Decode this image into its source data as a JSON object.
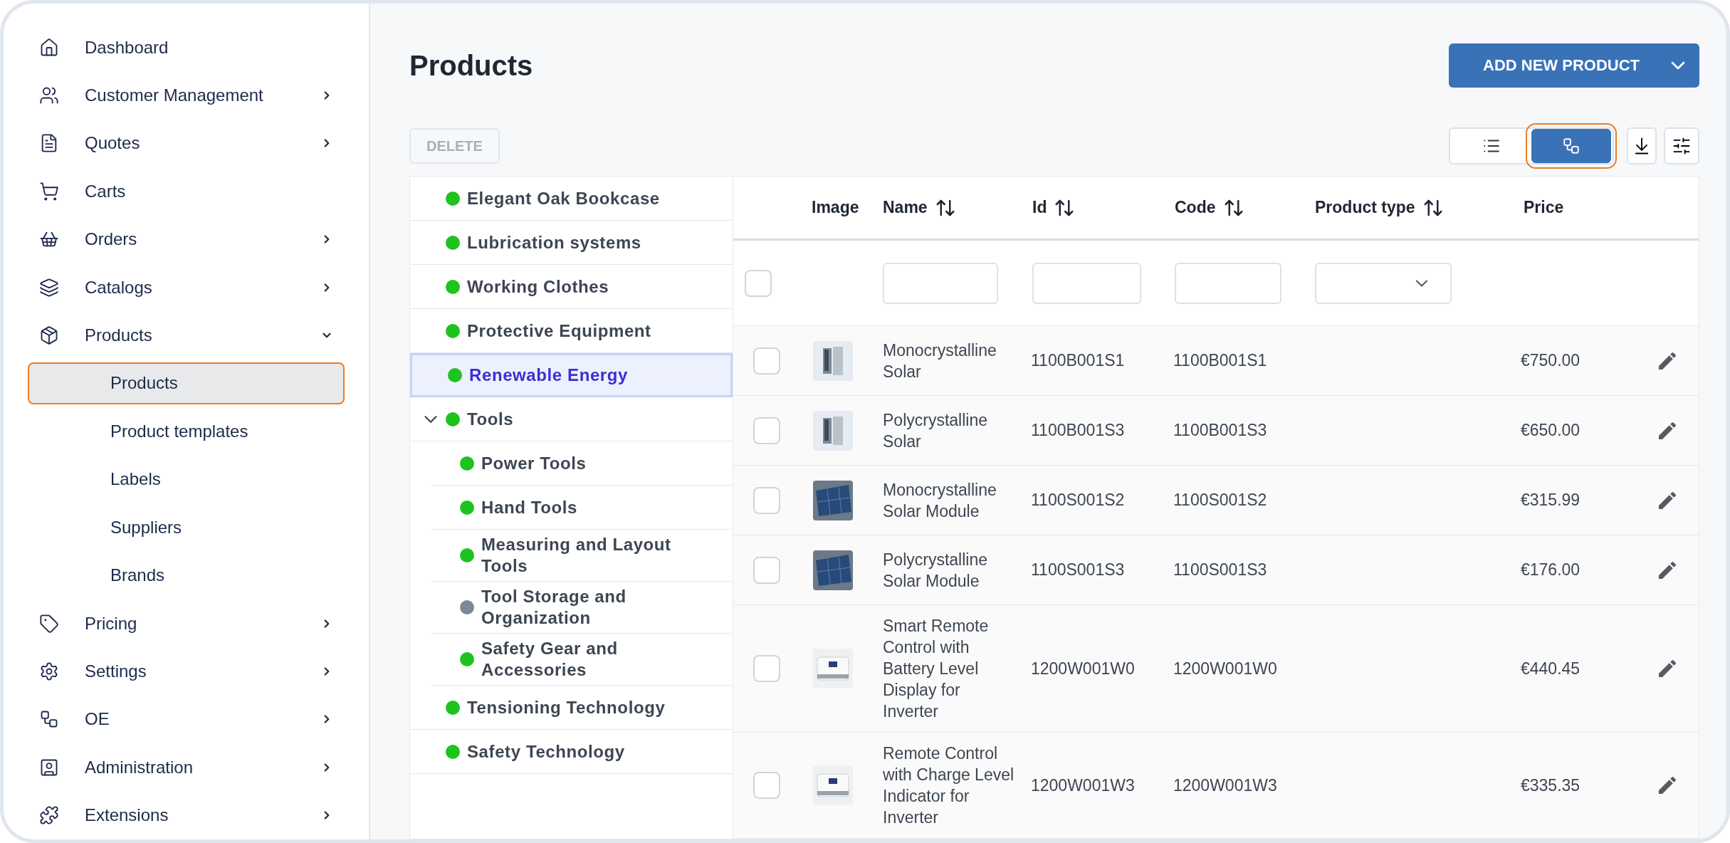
{
  "sidebar": {
    "items": [
      {
        "label": "Dashboard",
        "kind": "link",
        "selected": false
      },
      {
        "label": "Customer Management",
        "kind": "group",
        "expanded": false,
        "selected": false
      },
      {
        "label": "Quotes",
        "kind": "group",
        "expanded": false,
        "selected": false
      },
      {
        "label": "Carts",
        "kind": "link",
        "selected": false
      },
      {
        "label": "Orders",
        "kind": "group",
        "expanded": false,
        "selected": false
      },
      {
        "label": "Catalogs",
        "kind": "group",
        "expanded": false,
        "selected": false
      },
      {
        "label": "Products",
        "kind": "group",
        "expanded": true,
        "selected": false,
        "children": [
          {
            "label": "Products",
            "selected": true
          },
          {
            "label": "Product templates",
            "selected": false
          },
          {
            "label": "Labels",
            "selected": false
          },
          {
            "label": "Suppliers",
            "selected": false
          },
          {
            "label": "Brands",
            "selected": false
          }
        ]
      },
      {
        "label": "Pricing",
        "kind": "group",
        "expanded": false,
        "selected": false
      },
      {
        "label": "Settings",
        "kind": "group",
        "expanded": false,
        "selected": false
      },
      {
        "label": "OE",
        "kind": "group",
        "expanded": false,
        "selected": false
      },
      {
        "label": "Administration",
        "kind": "group",
        "expanded": false,
        "selected": false
      },
      {
        "label": "Extensions",
        "kind": "group",
        "expanded": false,
        "selected": false
      }
    ]
  },
  "page": {
    "title": "Products",
    "add_button": "ADD NEW PRODUCT",
    "delete_button": {
      "label": "DELETE",
      "disabled": true
    },
    "view_toggle": [
      {
        "kind": "list",
        "selected": false
      },
      {
        "kind": "tree",
        "selected": true
      }
    ]
  },
  "tree": [
    {
      "label": "Elegant Oak Bookcase",
      "color": "#1ec31e",
      "selected": false
    },
    {
      "label": "Lubrication systems",
      "color": "#1ec31e",
      "selected": false
    },
    {
      "label": "Working Clothes",
      "color": "#1ec31e",
      "selected": false
    },
    {
      "label": "Protective Equipment",
      "color": "#1ec31e",
      "selected": false
    },
    {
      "label": "Renewable Energy",
      "color": "#1ec31e",
      "selected": true
    },
    {
      "label": "Tools",
      "color": "#1ec31e",
      "selected": false,
      "expanded": true,
      "children": [
        {
          "label": "Power Tools",
          "color": "#1ec31e",
          "selected": false
        },
        {
          "label": "Hand Tools",
          "color": "#1ec31e",
          "selected": false
        },
        {
          "label": "Measuring and Layout Tools",
          "color": "#1ec31e",
          "selected": false
        },
        {
          "label": "Tool Storage and Organization",
          "color": "#7c8898",
          "selected": false
        },
        {
          "label": "Safety Gear and Accessories",
          "color": "#1ec31e",
          "selected": false
        }
      ]
    },
    {
      "label": "Tensioning Technology",
      "color": "#1ec31e",
      "selected": false
    },
    {
      "label": "Safety Technology",
      "color": "#1ec31e",
      "selected": false
    }
  ],
  "table": {
    "columns": [
      {
        "label": "Image",
        "kind": "plain"
      },
      {
        "label": "Name",
        "kind": "text"
      },
      {
        "label": "Id",
        "kind": "text"
      },
      {
        "label": "Code",
        "kind": "text"
      },
      {
        "label": "Product type",
        "kind": "select"
      },
      {
        "label": "Price",
        "kind": "plain"
      }
    ],
    "select_all": {
      "checked": false
    },
    "rows": [
      {
        "checked": false,
        "kind": "cabinet",
        "name": "Monocrystalline Solar",
        "id": "1100B001S1",
        "code": "1100B001S1",
        "price": "€750.00"
      },
      {
        "checked": false,
        "kind": "cabinet",
        "name": "Polycrystalline Solar",
        "id": "1100B001S3",
        "code": "1100B001S3",
        "price": "€650.00"
      },
      {
        "checked": false,
        "kind": "panel",
        "name": "Monocrystalline Solar Module",
        "id": "1100S001S2",
        "code": "1100S001S2",
        "price": "€315.99"
      },
      {
        "checked": false,
        "kind": "panel",
        "name": "Polycrystalline Solar Module",
        "id": "1100S001S3",
        "code": "1100S001S3",
        "price": "€176.00"
      },
      {
        "checked": false,
        "kind": "device",
        "name": "Smart Remote Control with Battery Level Display for Inverter",
        "id": "1200W001W0",
        "code": "1200W001W0",
        "price": "€440.45"
      },
      {
        "checked": false,
        "kind": "device",
        "name": "Remote Control with Charge Level Indicator for Inverter",
        "id": "1200W001W3",
        "code": "1200W001W3",
        "price": "€335.35"
      }
    ]
  }
}
